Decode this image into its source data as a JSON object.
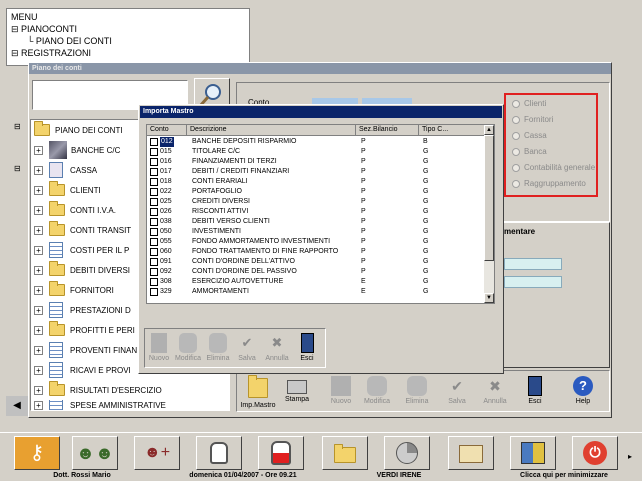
{
  "menu_tree": {
    "root": "MENU",
    "items": [
      "PIANOCONTI",
      "PIANO DEI CONTI",
      "REGISTRAZIONI"
    ]
  },
  "piano_window": {
    "title": "Piano dei conti",
    "conto_label": "Conto",
    "tree_root": "PIANO DEI CONTI",
    "tree_items": [
      "BANCHE C/C",
      "CASSA",
      "CLIENTI",
      "CONTI I.V.A.",
      "CONTI TRANSIT",
      "COSTI PER IL P",
      "DEBITI DIVERSI",
      "FORNITORI",
      "PRESTAZIONI D",
      "PROFITTI E PERI",
      "PROVENTI FINAN",
      "RICAVI E PROVI",
      "RISULTATI D'ESERCIZIO",
      "SPESE AMMINISTRATIVE"
    ],
    "radio_options": [
      "Clienti",
      "Fornitori",
      "Cassa",
      "Banca",
      "Contabilità generale",
      "Raggruppamento"
    ],
    "section_label": "mentare",
    "toolbar": [
      "Imp.Mastro",
      "Stampa",
      "Nuovo",
      "Modifica",
      "Elimina",
      "Salva",
      "Annulla",
      "Esci",
      "Help"
    ]
  },
  "dialog": {
    "title": "Importa Mastro",
    "columns": [
      "Conto",
      "Descrizione",
      "Sez.Bilancio",
      "Tipo C..."
    ],
    "rows": [
      {
        "conto": "012",
        "descr": "BANCHE DEPOSITI RISPARMIO",
        "sez": "P",
        "tipo": "B"
      },
      {
        "conto": "015",
        "descr": "TITOLARE C/C",
        "sez": "P",
        "tipo": "G"
      },
      {
        "conto": "016",
        "descr": "FINANZIAMENTI DI TERZI",
        "sez": "P",
        "tipo": "G"
      },
      {
        "conto": "017",
        "descr": "DEBITI / CREDITI FINANZIARI",
        "sez": "P",
        "tipo": "G"
      },
      {
        "conto": "018",
        "descr": "CONTI ERARIALI",
        "sez": "P",
        "tipo": "G"
      },
      {
        "conto": "022",
        "descr": "PORTAFOGLIO",
        "sez": "P",
        "tipo": "G"
      },
      {
        "conto": "025",
        "descr": "CREDITI DIVERSI",
        "sez": "P",
        "tipo": "G"
      },
      {
        "conto": "026",
        "descr": "RISCONTI ATTIVI",
        "sez": "P",
        "tipo": "G"
      },
      {
        "conto": "038",
        "descr": "DEBITI VERSO CLIENTI",
        "sez": "P",
        "tipo": "G"
      },
      {
        "conto": "050",
        "descr": "INVESTIMENTI",
        "sez": "P",
        "tipo": "G"
      },
      {
        "conto": "055",
        "descr": "FONDO AMMORTAMENTO INVESTIMENTI",
        "sez": "P",
        "tipo": "G"
      },
      {
        "conto": "060",
        "descr": "FONDO TRATTAMENTO DI FINE RAPPORTO",
        "sez": "P",
        "tipo": "G"
      },
      {
        "conto": "091",
        "descr": "CONTI D'ORDINE DELL'ATTIVO",
        "sez": "P",
        "tipo": "G"
      },
      {
        "conto": "092",
        "descr": "CONTI D'ORDINE DEL PASSIVO",
        "sez": "P",
        "tipo": "G"
      },
      {
        "conto": "308",
        "descr": "ESERCIZIO AUTOVETTURE",
        "sez": "E",
        "tipo": "G"
      },
      {
        "conto": "329",
        "descr": "AMMORTAMENTI",
        "sez": "E",
        "tipo": "G"
      }
    ],
    "toolbar": [
      "Nuovo",
      "Modifica",
      "Elimina",
      "Salva",
      "Annulla",
      "Esci"
    ]
  },
  "statusbar": {
    "user": "Dott. Rossi Mario",
    "datetime": "domenica 01/04/2007 - Ore 09.21",
    "patient": "VERDI IRENE",
    "minimize": "Clicca qui per minimizzare"
  },
  "colors": {
    "titlebar": "#0a246a",
    "selection": "#0a246a",
    "radio_frame": "#e02020",
    "window_bg": "#d4d0c8"
  }
}
